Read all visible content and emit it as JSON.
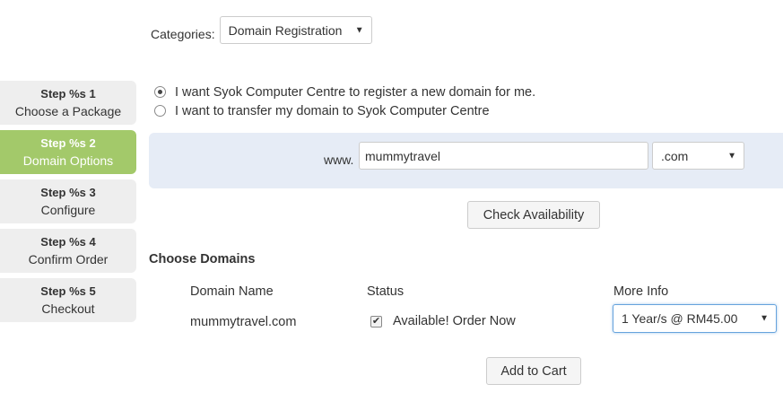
{
  "categories": {
    "label": "Categories:",
    "selected": "Domain Registration"
  },
  "steps": [
    {
      "num": "Step %s 1",
      "name": "Choose a Package",
      "active": false
    },
    {
      "num": "Step %s 2",
      "name": "Domain Options",
      "active": true
    },
    {
      "num": "Step %s 3",
      "name": "Configure",
      "active": false
    },
    {
      "num": "Step %s 4",
      "name": "Confirm Order",
      "active": false
    },
    {
      "num": "Step %s 5",
      "name": "Checkout",
      "active": false
    }
  ],
  "options": {
    "register": "I want Syok Computer Centre to register a new domain for me.",
    "transfer": "I want to transfer my domain to Syok Computer Centre",
    "selected": "register"
  },
  "domain": {
    "www_label": "www.",
    "name_value": "mummytravel",
    "tld_selected": ".com"
  },
  "buttons": {
    "check_availability": "Check Availability",
    "add_to_cart": "Add to Cart"
  },
  "choose_domains": {
    "title": "Choose Domains",
    "headers": {
      "name": "Domain Name",
      "status": "Status",
      "more_info": "More Info"
    },
    "rows": [
      {
        "domain": "mummytravel.com",
        "status": "Available! Order Now",
        "checked": true,
        "period": "1 Year/s @ RM45.00"
      }
    ]
  },
  "colors": {
    "active_step": "#a3c96a",
    "inactive_step": "#eeeeee",
    "panel_bg": "#e6ecf6",
    "focus_border": "#66a3dd"
  }
}
